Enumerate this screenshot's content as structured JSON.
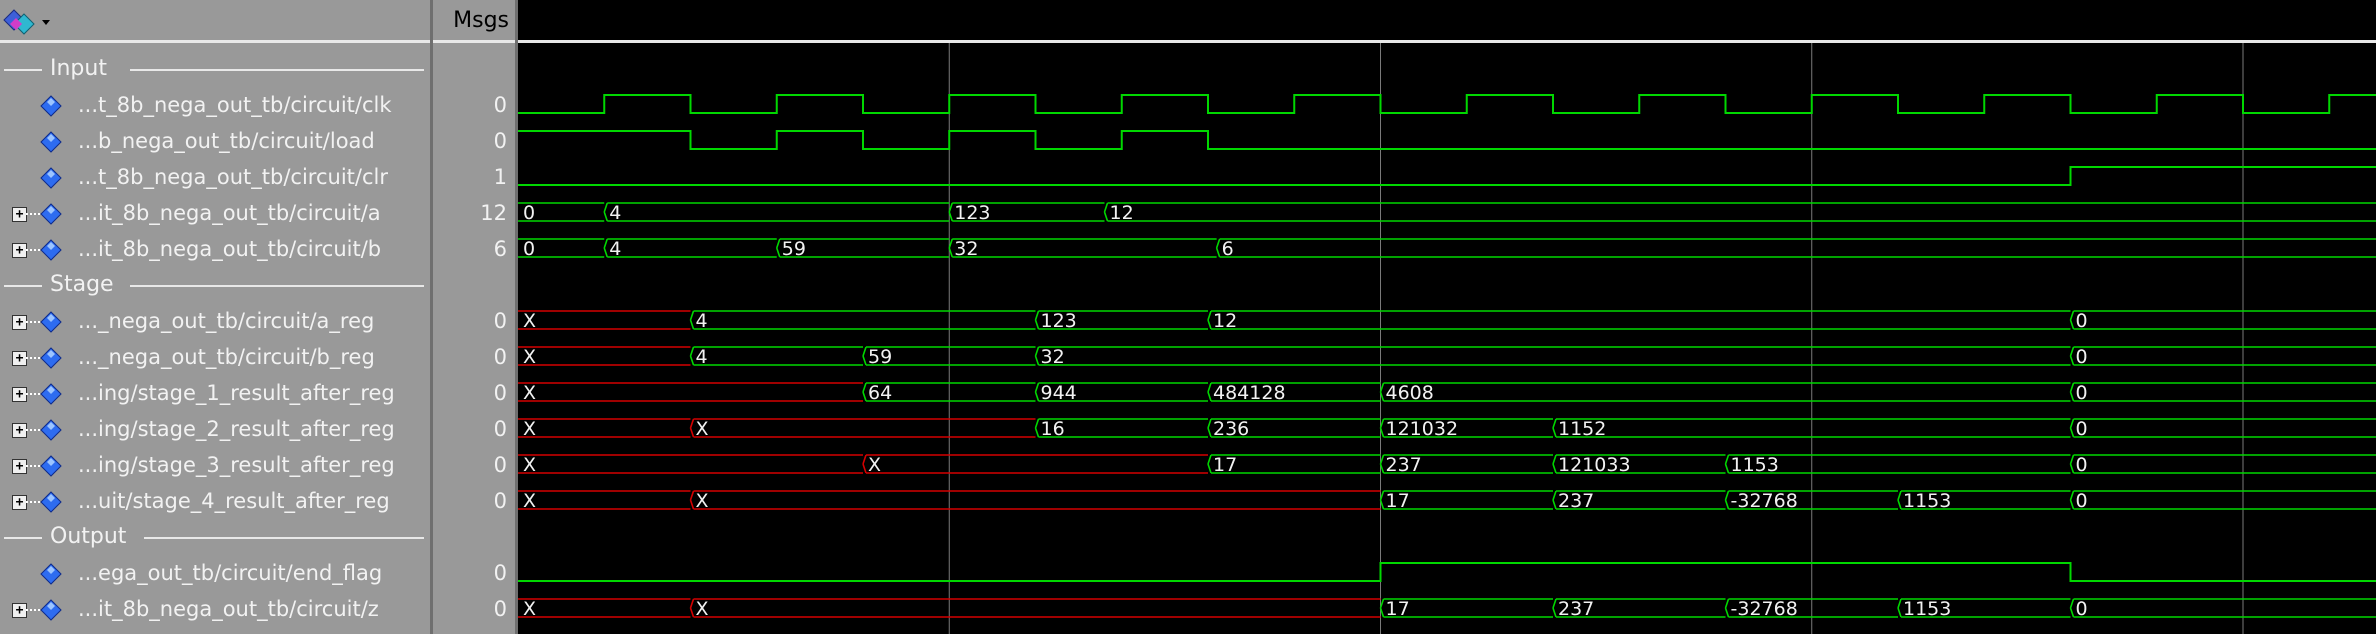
{
  "header": {
    "msgs_label": "Msgs"
  },
  "colors": {
    "signal_green": "#00d800",
    "unknown_red": "#d60000",
    "cursor_line": "#7a7a7a"
  },
  "timeline": {
    "end": 1200
  },
  "groups": [
    {
      "label": "Input",
      "row": 0
    },
    {
      "label": "Stage",
      "row": 6
    },
    {
      "label": "Output",
      "row": 13
    }
  ],
  "signals": [
    {
      "row": 1,
      "name": "...t_8b_nega_out_tb/circuit/clk",
      "msg": "0",
      "expandable": false,
      "kind": "bit",
      "edges": [
        [
          0,
          0
        ],
        [
          50,
          1
        ],
        [
          100,
          0
        ],
        [
          150,
          1
        ],
        [
          200,
          0
        ],
        [
          250,
          1
        ],
        [
          300,
          0
        ],
        [
          350,
          1
        ],
        [
          400,
          0
        ],
        [
          450,
          1
        ],
        [
          500,
          0
        ],
        [
          550,
          1
        ],
        [
          600,
          0
        ],
        [
          650,
          1
        ],
        [
          700,
          0
        ],
        [
          750,
          1
        ],
        [
          800,
          0
        ],
        [
          850,
          1
        ],
        [
          900,
          0
        ],
        [
          950,
          1
        ],
        [
          1000,
          0
        ],
        [
          1050,
          1
        ],
        [
          1100,
          0
        ],
        [
          1150,
          1
        ]
      ]
    },
    {
      "row": 2,
      "name": "...b_nega_out_tb/circuit/load",
      "msg": "0",
      "expandable": false,
      "kind": "bit",
      "edges": [
        [
          0,
          1
        ],
        [
          100,
          0
        ],
        [
          150,
          1
        ],
        [
          200,
          0
        ],
        [
          250,
          1
        ],
        [
          300,
          0
        ],
        [
          350,
          1
        ],
        [
          400,
          0
        ]
      ]
    },
    {
      "row": 3,
      "name": "...t_8b_nega_out_tb/circuit/clr",
      "msg": "1",
      "expandable": false,
      "kind": "bit",
      "edges": [
        [
          0,
          0
        ],
        [
          900,
          1
        ]
      ]
    },
    {
      "row": 4,
      "name": "...it_8b_nega_out_tb/circuit/a",
      "msg": "12",
      "expandable": true,
      "kind": "bus",
      "segs": [
        [
          0,
          "0"
        ],
        [
          50,
          "4"
        ],
        [
          250,
          "123"
        ],
        [
          340,
          "12"
        ]
      ]
    },
    {
      "row": 5,
      "name": "...it_8b_nega_out_tb/circuit/b",
      "msg": "6",
      "expandable": true,
      "kind": "bus",
      "segs": [
        [
          0,
          "0"
        ],
        [
          50,
          "4"
        ],
        [
          150,
          "59"
        ],
        [
          250,
          "32"
        ],
        [
          405,
          "6"
        ]
      ]
    },
    {
      "row": 7,
      "name": "..._nega_out_tb/circuit/a_reg",
      "msg": "0",
      "expandable": true,
      "kind": "bus",
      "segs": [
        [
          0,
          "X"
        ],
        [
          100,
          "4"
        ],
        [
          300,
          "123"
        ],
        [
          400,
          "12"
        ],
        [
          900,
          "0"
        ]
      ]
    },
    {
      "row": 8,
      "name": "..._nega_out_tb/circuit/b_reg",
      "msg": "0",
      "expandable": true,
      "kind": "bus",
      "segs": [
        [
          0,
          "X"
        ],
        [
          100,
          "4"
        ],
        [
          200,
          "59"
        ],
        [
          300,
          "32"
        ],
        [
          900,
          "0"
        ]
      ]
    },
    {
      "row": 9,
      "name": "...ing/stage_1_result_after_reg",
      "msg": "0",
      "expandable": true,
      "kind": "bus",
      "segs": [
        [
          0,
          "X"
        ],
        [
          200,
          "64"
        ],
        [
          300,
          "944"
        ],
        [
          400,
          "484128"
        ],
        [
          500,
          "4608"
        ],
        [
          900,
          "0"
        ]
      ]
    },
    {
      "row": 10,
      "name": "...ing/stage_2_result_after_reg",
      "msg": "0",
      "expandable": true,
      "kind": "bus",
      "segs": [
        [
          0,
          "X"
        ],
        [
          100,
          "X"
        ],
        [
          300,
          "16"
        ],
        [
          400,
          "236"
        ],
        [
          500,
          "121032"
        ],
        [
          600,
          "1152"
        ],
        [
          900,
          "0"
        ]
      ]
    },
    {
      "row": 11,
      "name": "...ing/stage_3_result_after_reg",
      "msg": "0",
      "expandable": true,
      "kind": "bus",
      "segs": [
        [
          0,
          "X"
        ],
        [
          200,
          "X"
        ],
        [
          400,
          "17"
        ],
        [
          500,
          "237"
        ],
        [
          600,
          "121033"
        ],
        [
          700,
          "1153"
        ],
        [
          900,
          "0"
        ]
      ]
    },
    {
      "row": 12,
      "name": "...uit/stage_4_result_after_reg",
      "msg": "0",
      "expandable": true,
      "kind": "bus",
      "segs": [
        [
          0,
          "X"
        ],
        [
          100,
          "X"
        ],
        [
          500,
          "17"
        ],
        [
          600,
          "237"
        ],
        [
          700,
          "-32768"
        ],
        [
          800,
          "1153"
        ],
        [
          900,
          "0"
        ]
      ]
    },
    {
      "row": 14,
      "name": "...ega_out_tb/circuit/end_flag",
      "msg": "0",
      "expandable": false,
      "kind": "bit",
      "edges": [
        [
          0,
          0
        ],
        [
          500,
          1
        ],
        [
          900,
          0
        ]
      ]
    },
    {
      "row": 15,
      "name": "...it_8b_nega_out_tb/circuit/z",
      "msg": "0",
      "expandable": true,
      "kind": "bus",
      "segs": [
        [
          0,
          "X"
        ],
        [
          100,
          "X"
        ],
        [
          500,
          "17"
        ],
        [
          600,
          "237"
        ],
        [
          700,
          "-32768"
        ],
        [
          800,
          "1153"
        ],
        [
          900,
          "0"
        ]
      ]
    }
  ],
  "cursors": [
    250,
    500,
    750,
    1000
  ]
}
